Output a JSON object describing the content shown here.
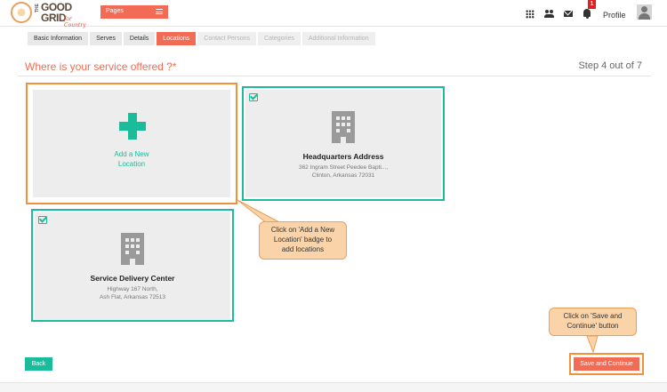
{
  "header": {
    "logo": {
      "the": "THE",
      "good": "GOOD",
      "grid": "GRID",
      "tagline": "for Country"
    },
    "pages_label": "Pages",
    "notification_count": "1",
    "profile_label": "Profile"
  },
  "tabs": [
    {
      "label": "Basic Information",
      "state": "done"
    },
    {
      "label": "Serves",
      "state": "done"
    },
    {
      "label": "Details",
      "state": "done"
    },
    {
      "label": "Locations",
      "state": "active"
    },
    {
      "label": "Contact Persons",
      "state": "disabled"
    },
    {
      "label": "Categories",
      "state": "disabled"
    },
    {
      "label": "Additional Information",
      "state": "disabled"
    }
  ],
  "main": {
    "question": "Where is your service offered ?*",
    "step": "Step 4 out of 7",
    "add_card": {
      "label": "Add a New\nLocation"
    },
    "locations": [
      {
        "title": "Headquarters Address",
        "address_line1": "362 Ingram Street Peedee Bapti...,",
        "address_line2": "Clinton, Arkansas 72031",
        "checked": true
      },
      {
        "title": "Service Delivery Center",
        "address_line1": "Highway 167 North,",
        "address_line2": "Ash Flat, Arkansas 72513",
        "checked": true
      }
    ]
  },
  "annotations": {
    "add_callout": "Click on 'Add a New\nLocation' badge to\nadd locations",
    "save_callout": "Click on 'Save and\nContinue' button"
  },
  "footer": {
    "back_label": "Back",
    "save_label": "Save and Continue"
  },
  "colors": {
    "accent": "#f26b54",
    "teal": "#1abc9c",
    "highlight": "#f0923a"
  }
}
